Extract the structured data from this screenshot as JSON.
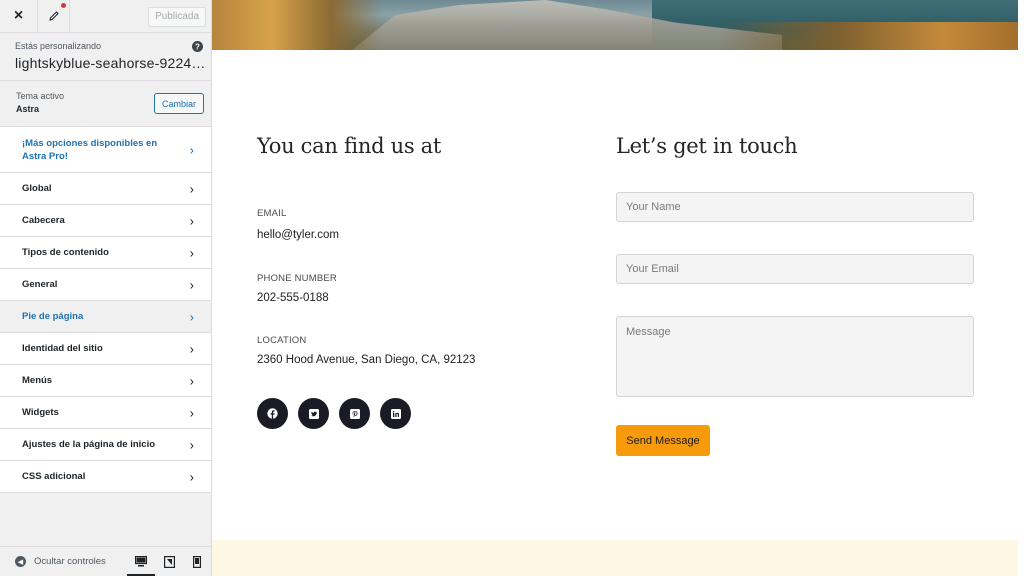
{
  "topbar": {
    "close_label": "×",
    "published_label": "Publicada"
  },
  "info": {
    "customizing_label": "Estás personalizando",
    "site_name": "lightskyblue-seahorse-922417..."
  },
  "theme": {
    "label": "Tema activo",
    "name": "Astra",
    "change_label": "Cambiar"
  },
  "menu": {
    "items": [
      {
        "label": "¡Más opciones disponibles en Astra Pro!"
      },
      {
        "label": "Global"
      },
      {
        "label": "Cabecera"
      },
      {
        "label": "Tipos de contenido"
      },
      {
        "label": "General"
      },
      {
        "label": "Pie de página"
      },
      {
        "label": "Identidad del sitio"
      },
      {
        "label": "Menús"
      },
      {
        "label": "Widgets"
      },
      {
        "label": "Ajustes de la página de inicio"
      },
      {
        "label": "CSS adicional"
      }
    ]
  },
  "footer": {
    "hide_controls_label": "Ocultar controles",
    "active_device": "desktop"
  },
  "contact": {
    "heading": "You can find us at",
    "email_label": "EMAIL",
    "email_value": "hello@tyler.com",
    "phone_label": "PHONE NUMBER",
    "phone_value": "202-555-0188",
    "location_label": "LOCATION",
    "location_value": "2360 Hood Avenue, San Diego, CA, 92123",
    "socials": [
      "facebook-icon",
      "twitter-icon",
      "pinterest-icon",
      "linkedin-icon"
    ]
  },
  "form": {
    "heading": "Let’s get in touch",
    "name_placeholder": "Your Name",
    "email_placeholder": "Your Email",
    "message_placeholder": "Message",
    "submit_label": "Send Message"
  },
  "colors": {
    "accent_button": "#f79a0c",
    "wp_blue": "#2271b1",
    "social_bg": "#1b1b26",
    "bottom_band": "#fdf7e5"
  }
}
